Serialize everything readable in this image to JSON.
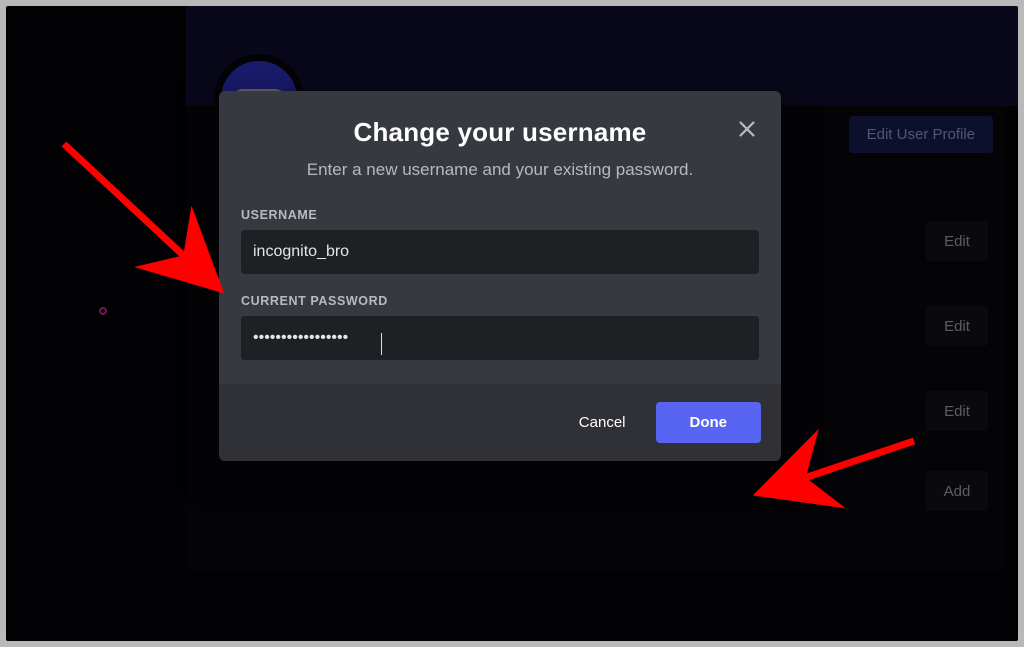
{
  "background": {
    "edit_user_profile_label": "Edit User Profile",
    "side_buttons": [
      "Edit",
      "Edit",
      "Edit",
      "Add"
    ]
  },
  "modal": {
    "title": "Change your username",
    "subtitle": "Enter a new username and your existing password.",
    "username_label": "USERNAME",
    "username_value": "incognito_bro",
    "password_label": "CURRENT PASSWORD",
    "password_masked": "•••••••••••••••••",
    "cancel": "Cancel",
    "done": "Done"
  },
  "colors": {
    "accent": "#5865f2",
    "modal_bg": "#36393f",
    "input_bg": "#1f2023"
  }
}
